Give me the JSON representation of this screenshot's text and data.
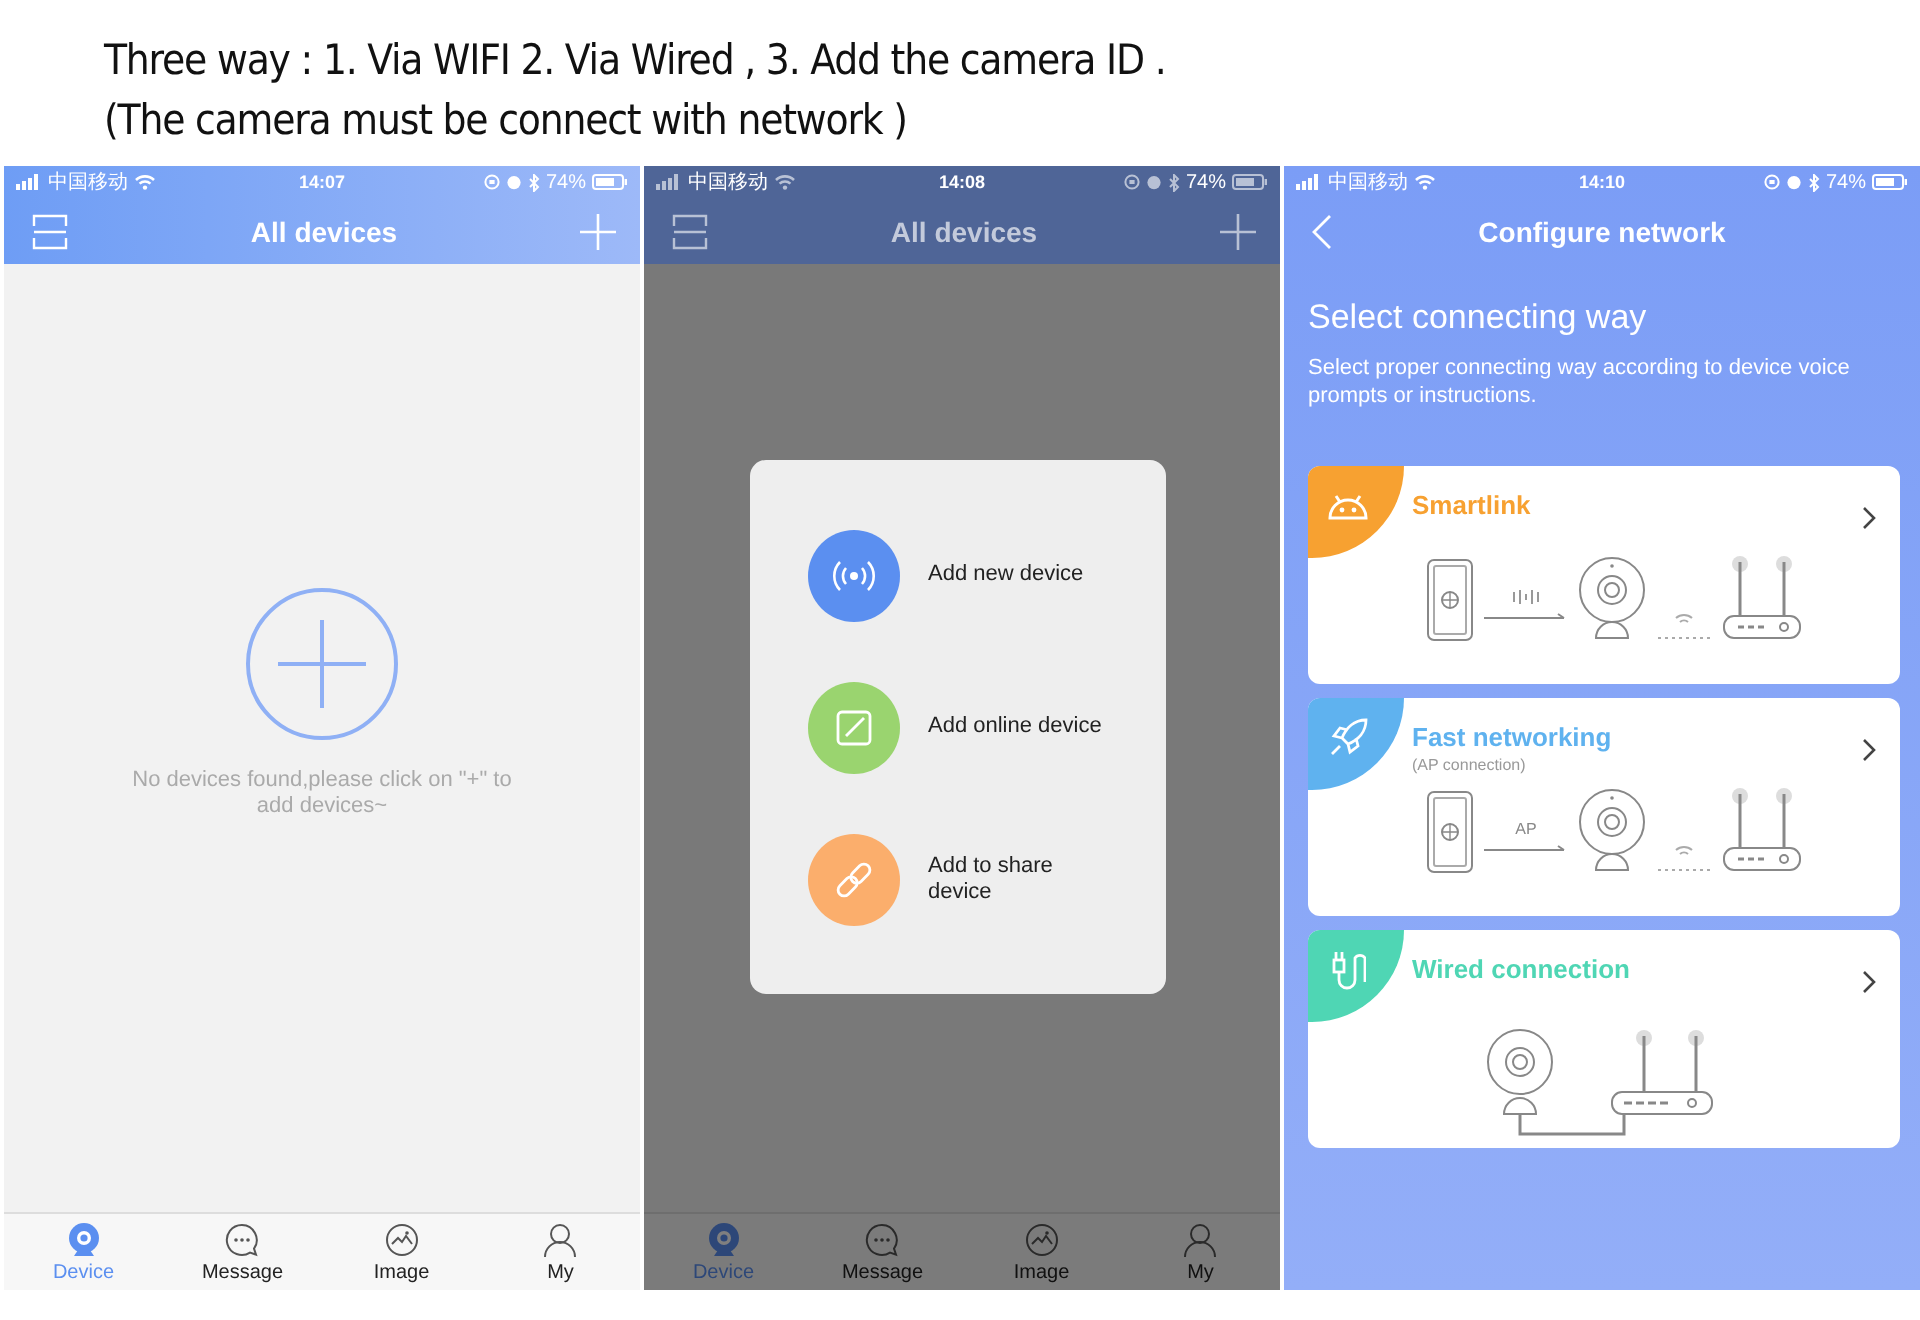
{
  "caption": {
    "lines": [
      "Three way : 1. Via WIFI 2. Via Wired , 3. Add the camera ID .",
      "(The camera must be connect with network )"
    ]
  },
  "screens": [
    {
      "kind": "device_list",
      "dimmed": false,
      "status_bar": {
        "carrier": "中国移动",
        "time": "14:07",
        "battery": "74%"
      },
      "title": "All devices",
      "empty_message": "No devices found,please click on \"+\" to add devices~",
      "tabs": [
        {
          "label": "Device",
          "selected": true
        },
        {
          "label": "Message",
          "selected": false
        },
        {
          "label": "Image",
          "selected": false
        },
        {
          "label": "My",
          "selected": false
        }
      ]
    },
    {
      "kind": "device_list",
      "dimmed": true,
      "status_bar": {
        "carrier": "中国移动",
        "time": "14:08",
        "battery": "74%"
      },
      "title": "All devices",
      "tabs": [
        {
          "label": "Device",
          "selected": true
        },
        {
          "label": "Message",
          "selected": false
        },
        {
          "label": "Image",
          "selected": false
        },
        {
          "label": "My",
          "selected": false
        }
      ],
      "popup": {
        "items": [
          {
            "kind": "new",
            "label": "Add new device",
            "color": "#5b8ff0"
          },
          {
            "kind": "online",
            "label": "Add online device",
            "color": "#9ad46f"
          },
          {
            "kind": "share",
            "label": "Add to share device",
            "color": "#fbae6c"
          }
        ]
      }
    },
    {
      "kind": "configure",
      "status_bar": {
        "carrier": "中国移动",
        "time": "14:10",
        "battery": "74%"
      },
      "title": "Configure network",
      "heading": "Select connecting way",
      "description": "Select proper connecting way according to device voice prompts or instructions.",
      "options": [
        {
          "kind": "smartlink",
          "title": "Smartlink",
          "color": "#f7a131"
        },
        {
          "kind": "ap",
          "title": "Fast networking",
          "subtitle": "(AP connection)",
          "diagram_label": "AP",
          "color": "#5fb2ef"
        },
        {
          "kind": "wired",
          "title": "Wired connection",
          "color": "#4fd6b4"
        }
      ]
    }
  ]
}
